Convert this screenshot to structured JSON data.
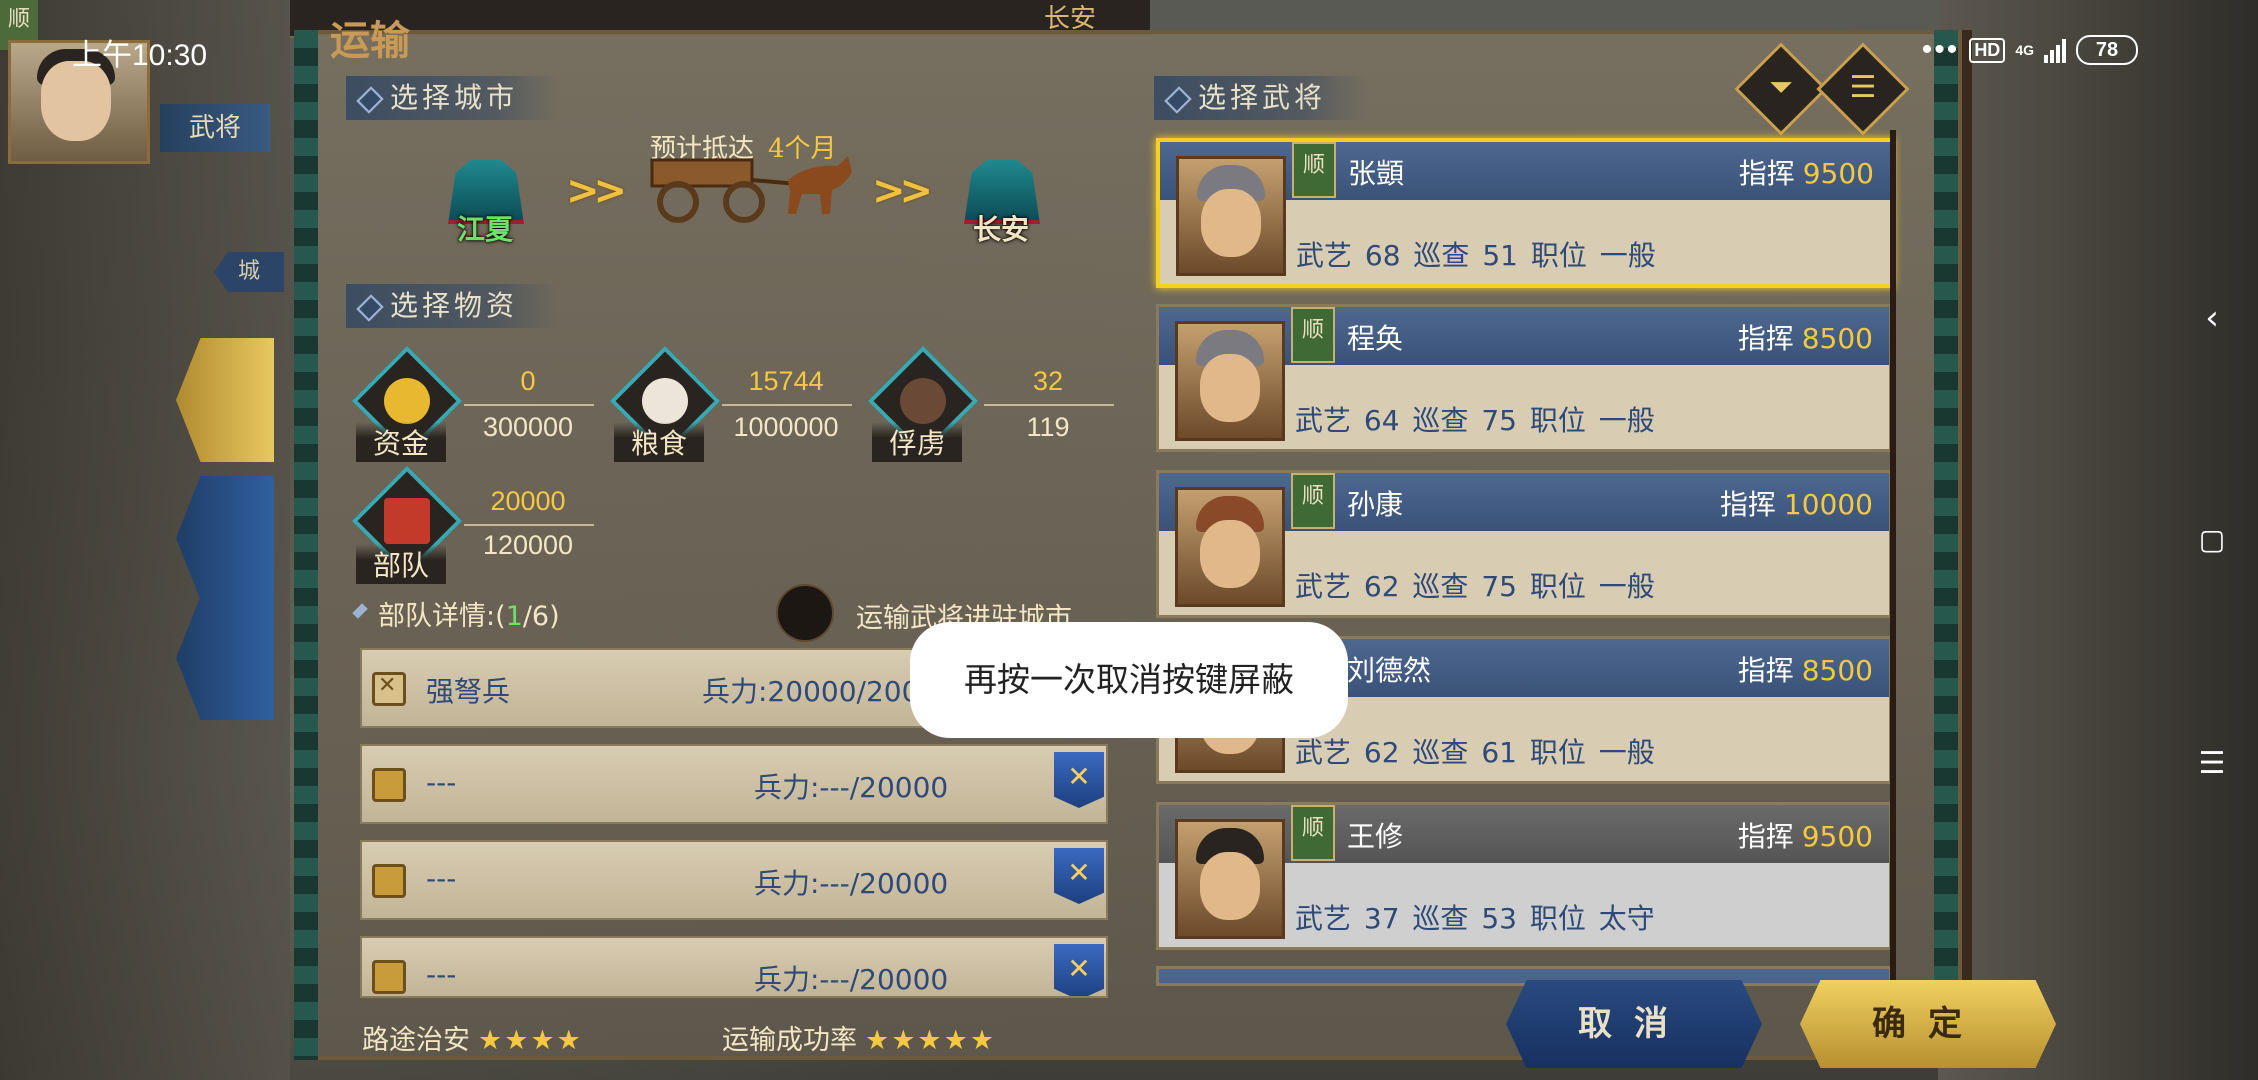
{
  "status_bar": {
    "time": "上午10:30",
    "dots": "•••",
    "hd": "HD",
    "network": "4G",
    "battery": "78"
  },
  "background": {
    "top_city": "长安",
    "faction_tag": "顺",
    "wujiang_tab": "武将",
    "city_tab": "城"
  },
  "panel": {
    "title": "运输",
    "section_city": "选择城市",
    "section_supplies": "选择物资",
    "section_general": "选择武将",
    "eta_label": "预计抵达",
    "eta_value": "4个月",
    "from_city": "江夏",
    "to_city": "长安",
    "arrows": ">>"
  },
  "resources": [
    {
      "label": "资金",
      "current": "0",
      "max": "300000"
    },
    {
      "label": "粮食",
      "current": "15744",
      "max": "1000000"
    },
    {
      "label": "俘虏",
      "current": "32",
      "max": "119"
    },
    {
      "label": "部队",
      "current": "20000",
      "max": "120000"
    }
  ],
  "troops": {
    "detail_label": "部队详情:(",
    "detail_current": "1",
    "detail_total": "/6)",
    "toggle_label": "运输武将进驻城市",
    "rows": [
      {
        "name": "强弩兵",
        "force": "兵力:20000/20000"
      },
      {
        "name": "---",
        "force": "兵力:---/20000"
      },
      {
        "name": "---",
        "force": "兵力:---/20000"
      },
      {
        "name": "---",
        "force": "兵力:---/20000"
      }
    ]
  },
  "footer": {
    "route_security_label": "路途治安",
    "route_security_stars": "★★★★",
    "success_rate_label": "运输成功率",
    "success_rate_stars": "★★★★★"
  },
  "generals": [
    {
      "faction": "顺",
      "name": "张顗",
      "command_label": "指挥",
      "command": "9500",
      "stats": "武艺 68  巡查 51  职位 一般"
    },
    {
      "faction": "顺",
      "name": "程奂",
      "command_label": "指挥",
      "command": "8500",
      "stats": "武艺 64  巡查 75  职位 一般"
    },
    {
      "faction": "顺",
      "name": "孙康",
      "command_label": "指挥",
      "command": "10000",
      "stats": "武艺 62  巡查 75  职位 一般"
    },
    {
      "faction": "顺",
      "name": "刘德然",
      "command_label": "指挥",
      "command": "8500",
      "stats": "武艺 62  巡查 61  职位 一般"
    },
    {
      "faction": "顺",
      "name": "王修",
      "command_label": "指挥",
      "command": "9500",
      "stats": "武艺 37  巡查 53  职位 太守"
    }
  ],
  "buttons": {
    "cancel": "取消",
    "confirm": "确定",
    "filter_icon": "funnel-icon",
    "list_icon": "list-icon"
  },
  "toast": "再按一次取消按键屏蔽"
}
